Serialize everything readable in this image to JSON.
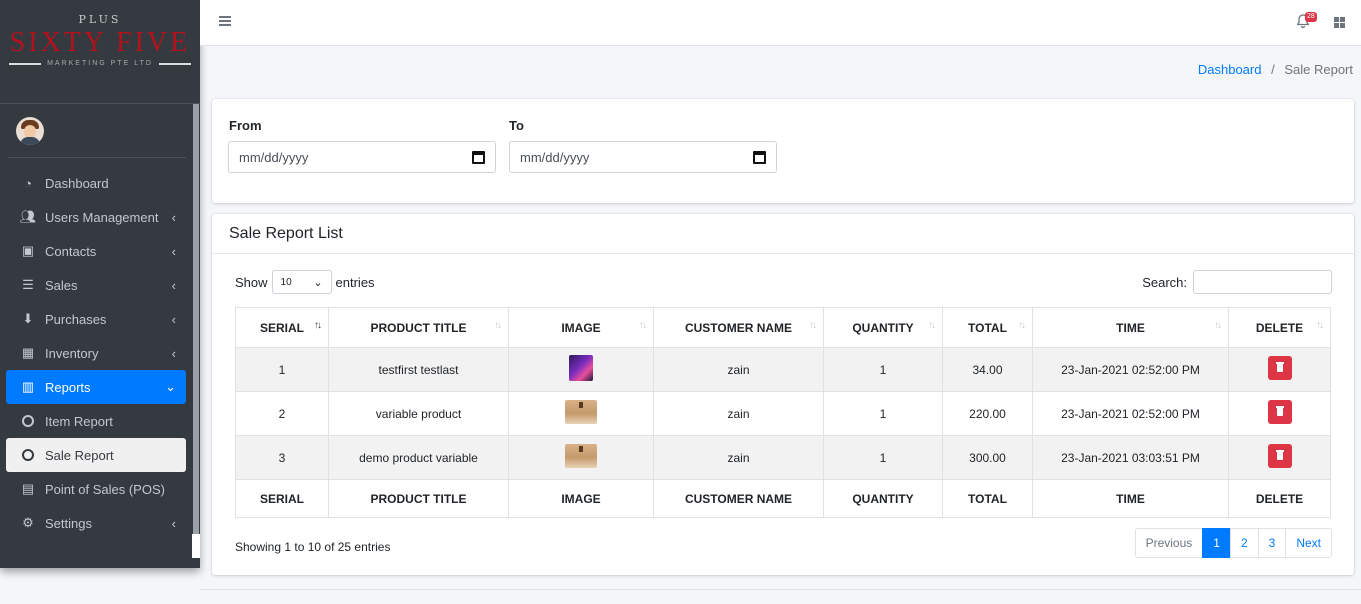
{
  "brand": {
    "top": "PLUS",
    "name": "SIXTY FIVE",
    "tagline": "MARKETING PTE LTD"
  },
  "sidebar": {
    "items": [
      {
        "label": "Dashboard",
        "icon": "tachometer-icon"
      },
      {
        "label": "Users Management",
        "icon": "users-icon"
      },
      {
        "label": "Contacts",
        "icon": "address-book-icon"
      },
      {
        "label": "Sales",
        "icon": "list-icon"
      },
      {
        "label": "Purchases",
        "icon": "download-circle-icon"
      },
      {
        "label": "Inventory",
        "icon": "cubes-icon"
      },
      {
        "label": "Reports",
        "icon": "bar-chart-icon"
      },
      {
        "label": "Item Report",
        "icon": "circle-icon"
      },
      {
        "label": "Sale Report",
        "icon": "circle-icon"
      },
      {
        "label": "Point of Sales (POS)",
        "icon": "pos-icon"
      },
      {
        "label": "Settings",
        "icon": "gear-icon"
      }
    ]
  },
  "topbar": {
    "notification_count": "28"
  },
  "breadcrumb": {
    "home": "Dashboard",
    "separator": "/",
    "current": "Sale Report"
  },
  "filter": {
    "from_label": "From",
    "from_value": "mm/dd/yyyy",
    "to_label": "To",
    "to_value": "mm/dd/yyyy"
  },
  "list": {
    "title": "Sale Report List",
    "show_label": "Show",
    "entries_value": "10",
    "entries_label": "entries",
    "search_label": "Search:",
    "columns": [
      "SERIAL",
      "PRODUCT TITLE",
      "IMAGE",
      "CUSTOMER NAME",
      "QUANTITY",
      "TOTAL",
      "TIME",
      "DELETE"
    ],
    "rows": [
      {
        "serial": "1",
        "title": "testfirst testlast",
        "image": "phone",
        "customer": "zain",
        "quantity": "1",
        "total": "34.00",
        "time": "23-Jan-2021 02:52:00 PM"
      },
      {
        "serial": "2",
        "title": "variable product",
        "image": "box",
        "customer": "zain",
        "quantity": "1",
        "total": "220.00",
        "time": "23-Jan-2021 02:52:00 PM"
      },
      {
        "serial": "3",
        "title": "demo product variable",
        "image": "box",
        "customer": "zain",
        "quantity": "1",
        "total": "300.00",
        "time": "23-Jan-2021 03:03:51 PM"
      }
    ],
    "info": "Showing 1 to 10 of 25 entries",
    "pager": {
      "previous": "Previous",
      "pages": [
        "1",
        "2",
        "3"
      ],
      "next": "Next"
    }
  },
  "colors": {
    "accent": "#007bff",
    "danger": "#dc3545",
    "sidebar": "#343a40",
    "brand_red": "#b3121d"
  }
}
